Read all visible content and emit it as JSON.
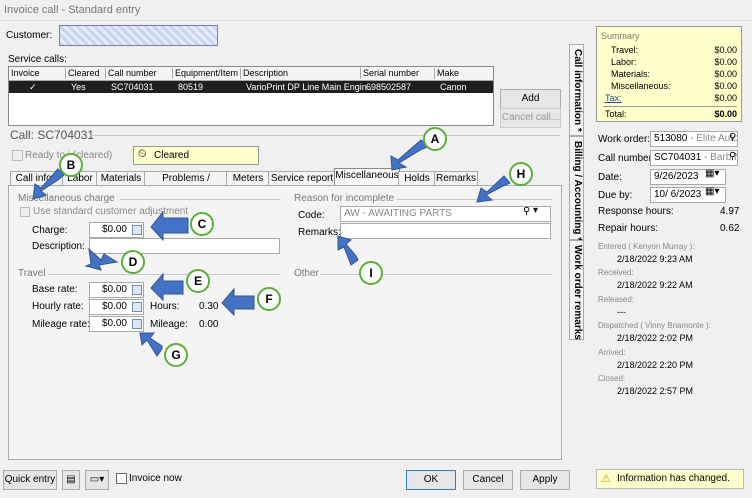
{
  "window": {
    "title": "Invoice call - Standard entry"
  },
  "customer": {
    "label": "Customer:"
  },
  "service_calls": {
    "label": "Service calls:",
    "columns": [
      "Invoice",
      "Cleared",
      "Call number",
      "Equipment/Item",
      "Description",
      "Serial number",
      "Make"
    ],
    "row": {
      "invoice": "✓",
      "cleared": "Yes",
      "call_number": "SC704031",
      "equipment": "80519",
      "description": "VarioPrint DP Line Main Engin...",
      "serial": "698502587",
      "make": "Canon"
    },
    "add_label": "Add",
    "cancel_label": "Cancel call..."
  },
  "call": {
    "title": "Call: SC704031",
    "ready_label": "Ready to i   (cleared)",
    "status": "Cleared"
  },
  "tabs": [
    "Call info *",
    "Labor",
    "Materials",
    "Problems / Repairs",
    "Meters",
    "Service report",
    "Miscellaneous",
    "Holds",
    "Remarks"
  ],
  "misc": {
    "section": "Miscellaneous charge",
    "use_std_label": "Use standard customer adjustment",
    "charge_label": "Charge:",
    "charge_value": "$0.00",
    "description_label": "Description:"
  },
  "travel": {
    "section": "Travel",
    "base_label": "Base rate:",
    "base_value": "$0.00",
    "hourly_label": "Hourly rate:",
    "hourly_value": "$0.00",
    "hours_label": "Hours:",
    "hours_value": "0.30",
    "mileage_rate_label": "Mileage rate:",
    "mileage_rate_value": "$0.00",
    "mileage_label": "Mileage:",
    "mileage_value": "0.00"
  },
  "reason": {
    "section": "Reason for incomplete",
    "code_label": "Code:",
    "code_value": "AW - AWAITING PARTS",
    "remarks_label": "Remarks:"
  },
  "other": {
    "section": "Other"
  },
  "callouts": [
    "A",
    "B",
    "C",
    "D",
    "E",
    "F",
    "G",
    "H",
    "I"
  ],
  "side_tabs": [
    "Call information *",
    "Billing / Accounting *",
    "Work order remarks"
  ],
  "summary": {
    "title": "Summary",
    "rows": [
      {
        "label": "Travel:",
        "value": "$0.00"
      },
      {
        "label": "Labor:",
        "value": "$0.00"
      },
      {
        "label": "Materials:",
        "value": "$0.00"
      },
      {
        "label": "Miscellaneous:",
        "value": "$0.00"
      },
      {
        "label": "Tax:",
        "value": "$0.00"
      }
    ],
    "total_label": "Total:",
    "total_value": "$0.00"
  },
  "right": {
    "work_order_label": "Work order:",
    "work_order_value": "513080",
    "work_order_hint": "- Elite Auto I",
    "call_number_label": "Call number:",
    "call_number_value": "SC704031",
    "call_number_hint": "- Barb Nu",
    "date_label": "Date:",
    "date_value": "9/26/2023",
    "due_label": "Due by:",
    "due_value": "10/ 6/2023",
    "response_label": "Response hours:",
    "response_value": "4.97",
    "repair_label": "Repair hours:",
    "repair_value": "0.62",
    "entered_label": "Entered ( Kenyon Murray ):",
    "entered_value": "2/18/2022 9:23 AM",
    "received_label": "Received:",
    "received_value": "2/18/2022 9:22 AM",
    "released_label": "Released:",
    "released_value": "---",
    "dispatched_label": "Dispatched ( Vinny Briamonte ):",
    "dispatched_value": "2/18/2022 2:02 PM",
    "arrived_label": "Arrived:",
    "arrived_value": "2/18/2022 2:20 PM",
    "closed_label": "Closed:",
    "closed_value": "2/18/2022 2:57 PM"
  },
  "bottom": {
    "quick_entry": "Quick entry",
    "invoice_now": "Invoice now",
    "ok": "OK",
    "cancel": "Cancel",
    "apply": "Apply",
    "status": "Information has changed."
  }
}
